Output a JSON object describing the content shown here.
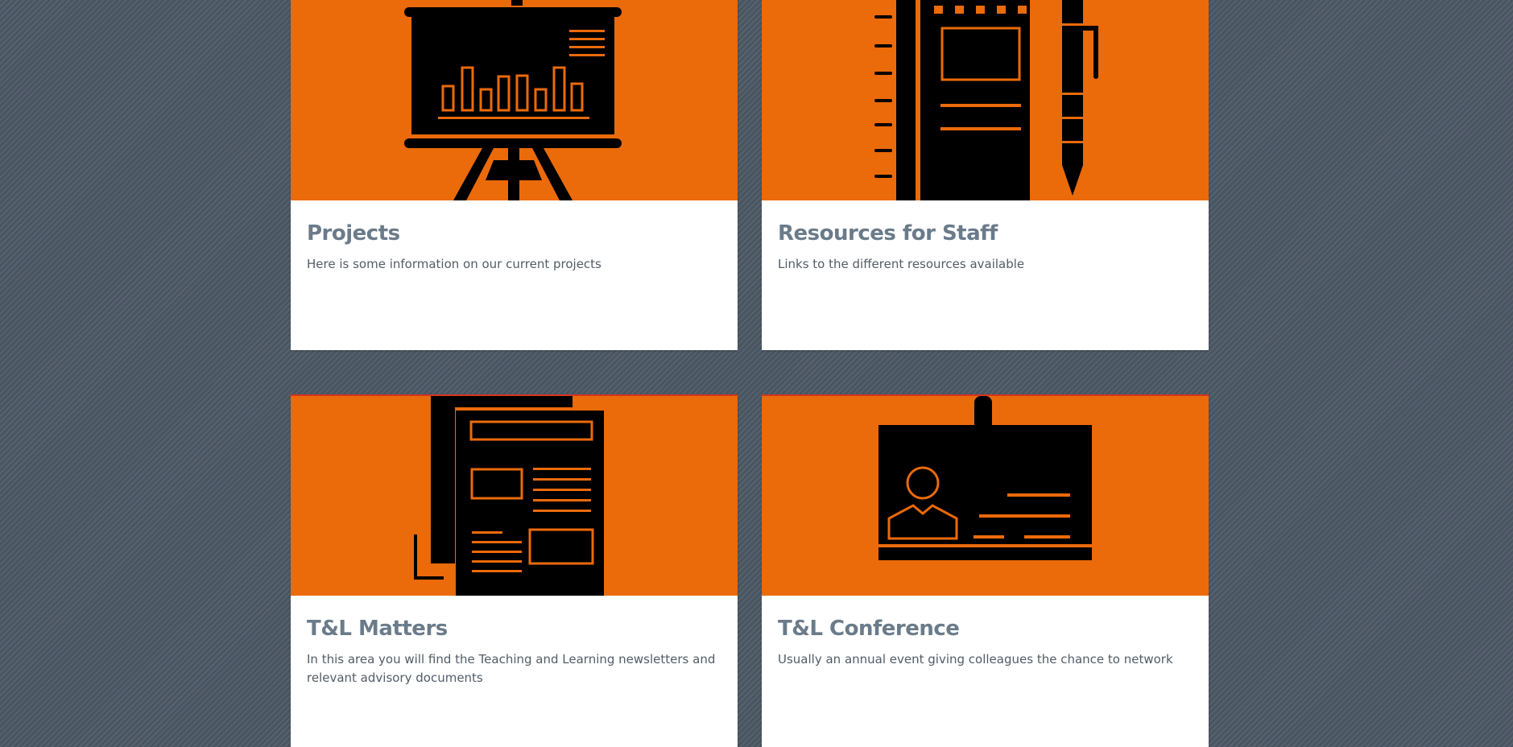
{
  "cards": [
    {
      "title": "Projects",
      "description": "Here is some information on our current projects",
      "icon": "presentation-board-icon"
    },
    {
      "title": "Resources for Staff",
      "description": "Links to the different resources available",
      "icon": "notebook-pen-icon"
    },
    {
      "title": "T&L Matters",
      "description": "In this area you will find the Teaching and Learning newsletters and relevant advisory documents",
      "icon": "newspaper-icon"
    },
    {
      "title": "T&L Conference",
      "description": "Usually an annual event giving colleagues the chance to network",
      "icon": "id-badge-icon"
    }
  ],
  "colors": {
    "accent": "#eb6a0a",
    "icon": "#000000",
    "title": "#6a7b8a",
    "text": "#525c66",
    "background": "#4d5866"
  }
}
